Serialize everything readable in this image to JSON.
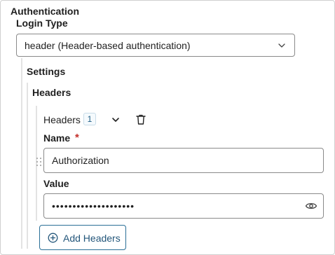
{
  "section": {
    "title": "Authentication"
  },
  "login_type": {
    "label": "Login Type",
    "selected": "header (Header-based authentication)",
    "icon": "chevron-down-icon"
  },
  "settings": {
    "label": "Settings",
    "headers": {
      "label": "Headers",
      "item": {
        "title": "Headers",
        "count": "1",
        "collapse_icon": "chevron-down-icon",
        "delete_icon": "trash-icon",
        "drag_icon": "drag-handle-icon",
        "name": {
          "label": "Name",
          "required_mark": "*",
          "value": "Authorization"
        },
        "value": {
          "label": "Value",
          "masked_value": "••••••••••••••••••••",
          "toggle_icon": "eye-icon"
        }
      },
      "add_button": {
        "label": "Add Headers",
        "icon": "plus-circle-icon"
      }
    }
  },
  "colors": {
    "accent": "#2a6f97",
    "required": "#c4302b",
    "border": "#8a8a8a",
    "guide": "#e3e3e3"
  }
}
